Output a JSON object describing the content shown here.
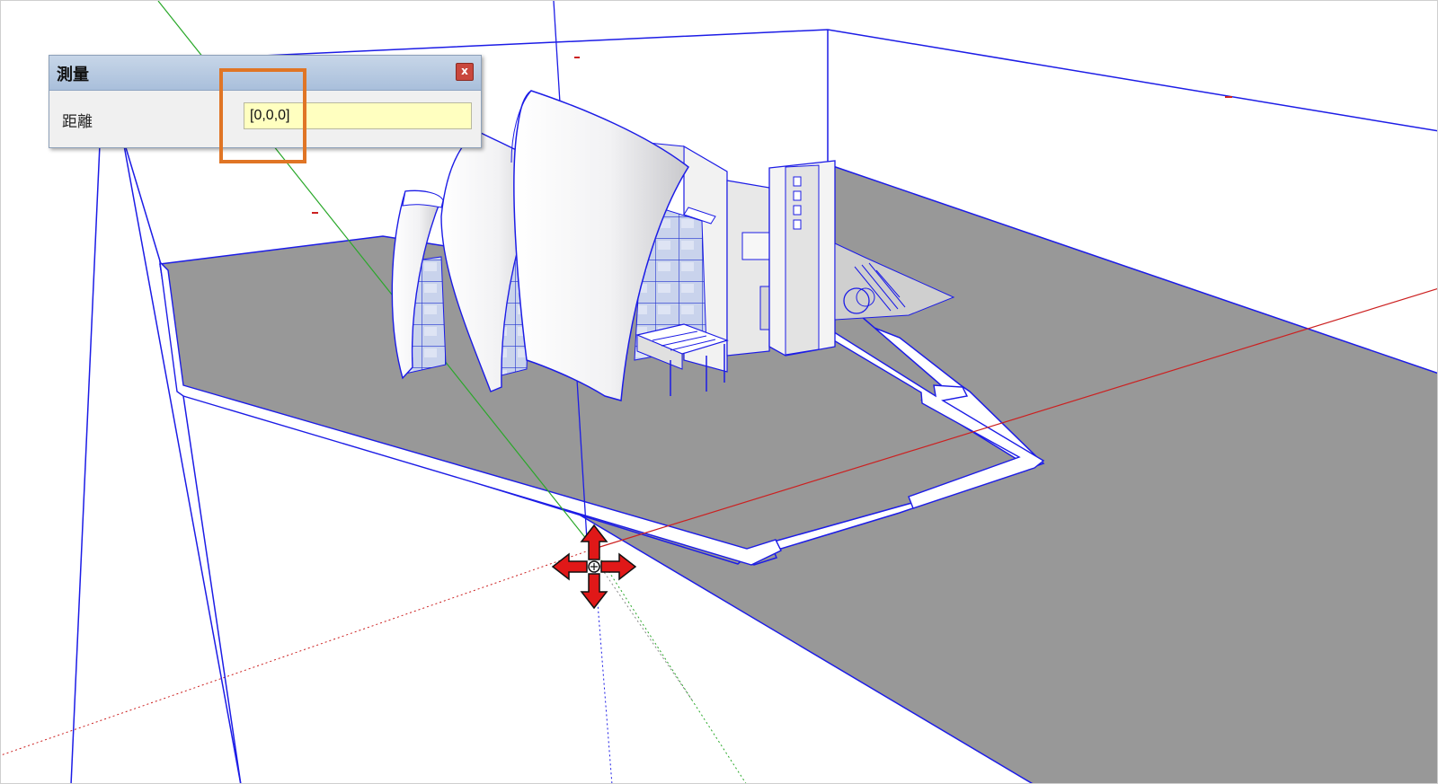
{
  "dialog": {
    "title": "測量",
    "close_label": "x",
    "field_label": "距離",
    "field_value": "[0,0,0]"
  },
  "colors": {
    "edge_blue": "#1c1ce6",
    "ground_gray": "#989898",
    "axis_red": "#cc2020",
    "axis_green": "#29a829",
    "move_cursor_red": "#e01818",
    "callout_orange": "#e07525",
    "input_bg": "#ffffc0"
  },
  "icons": {
    "move_cursor": "move-cursor-icon",
    "close": "close-icon"
  }
}
